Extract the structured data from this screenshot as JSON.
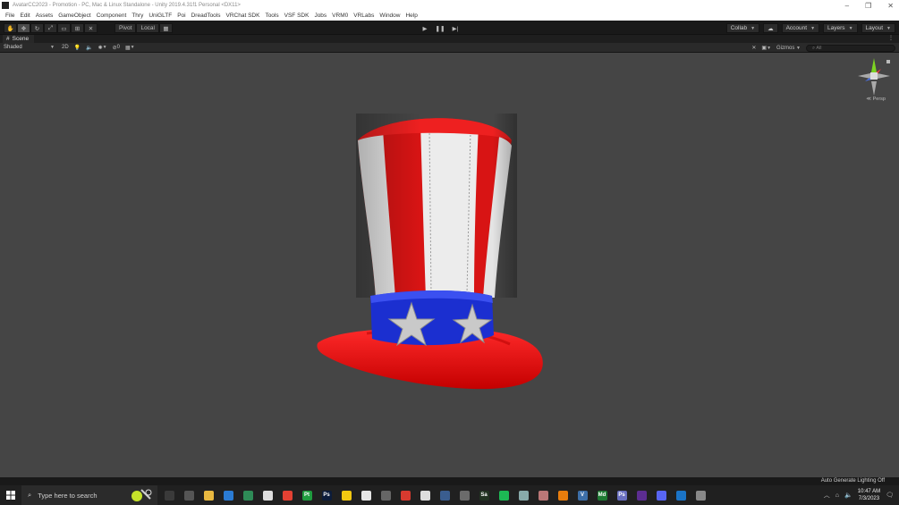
{
  "window": {
    "title": "AvatarCC2023 - Promotion - PC, Mac & Linux Standalone - Unity 2019.4.31f1 Personal <DX11>",
    "controls": [
      "–",
      "❐",
      "✕"
    ]
  },
  "menu": [
    "File",
    "Edit",
    "Assets",
    "GameObject",
    "Component",
    "Thry",
    "UniGLTF",
    "Poi",
    "DreadTools",
    "VRChat SDK",
    "Tools",
    "VSF SDK",
    "Jobs",
    "VRM0",
    "VRLabs",
    "Window",
    "Help"
  ],
  "toolbar": {
    "pivot_label": "Pivot",
    "local_label": "Local",
    "collab_label": "Collab",
    "account_label": "Account",
    "layers_label": "Layers",
    "layout_label": "Layout"
  },
  "scene": {
    "tab_label": "Scene",
    "shading_mode": "Shaded",
    "mode_2d": "2D",
    "fx_count": "0",
    "gizmos_label": "Gizmos",
    "search_placeholder": "All",
    "projection_label": "Persp"
  },
  "status": {
    "lighting": "Auto Generate Lighting Off"
  },
  "taskbar": {
    "search_placeholder": "Type here to search",
    "time": "10:47 AM",
    "date": "7/3/2023",
    "apps": [
      {
        "icon": "terminal-icon",
        "text": "",
        "bg": "#3a3a3a"
      },
      {
        "icon": "globe-icon",
        "text": "",
        "bg": "#555"
      },
      {
        "icon": "folder-icon",
        "text": "",
        "bg": "#e8b840"
      },
      {
        "icon": "chat-icon",
        "text": "",
        "bg": "#2a7bd4"
      },
      {
        "icon": "leaf-icon",
        "text": "",
        "bg": "#2e8b57"
      },
      {
        "icon": "unity-icon",
        "text": "",
        "bg": "#ddd"
      },
      {
        "icon": "chrome-icon",
        "text": "",
        "bg": "#e34133"
      },
      {
        "icon": "pycharm-icon",
        "text": "Pt",
        "bg": "#1f9c3f"
      },
      {
        "icon": "photoshop-icon",
        "text": "Ps",
        "bg": "#0c1c3a"
      },
      {
        "icon": "notes-icon",
        "text": "",
        "bg": "#f2c811"
      },
      {
        "icon": "window-icon",
        "text": "",
        "bg": "#e6e6e6"
      },
      {
        "icon": "shield-icon",
        "text": "",
        "bg": "#666"
      },
      {
        "icon": "red-app-icon",
        "text": "",
        "bg": "#d83a2f"
      },
      {
        "icon": "github-icon",
        "text": "",
        "bg": "#ddd"
      },
      {
        "icon": "blender-icon",
        "text": "",
        "bg": "#3a5d8f"
      },
      {
        "icon": "calculator-icon",
        "text": "",
        "bg": "#6b6b6b"
      },
      {
        "icon": "substance-icon",
        "text": "Sa",
        "bg": "#213321"
      },
      {
        "icon": "spotify-icon",
        "text": "",
        "bg": "#1db954"
      },
      {
        "icon": "cube-icon",
        "text": "",
        "bg": "#8aa"
      },
      {
        "icon": "image-icon",
        "text": "",
        "bg": "#b77"
      },
      {
        "icon": "blender-alt-icon",
        "text": "",
        "bg": "#e87d0d"
      },
      {
        "icon": "vroid-icon",
        "text": "V",
        "bg": "#3d6fa8"
      },
      {
        "icon": "marvelous-icon",
        "text": "Md",
        "bg": "#1e7a33"
      },
      {
        "icon": "photoshop-alt-icon",
        "text": "Ps",
        "bg": "#6a6fc0"
      },
      {
        "icon": "vs-icon",
        "text": "",
        "bg": "#5c2d91"
      },
      {
        "icon": "discord-icon",
        "text": "",
        "bg": "#5865f2"
      },
      {
        "icon": "video-icon",
        "text": "",
        "bg": "#1a73c6"
      },
      {
        "icon": "vscode-icon",
        "text": "",
        "bg": "#888"
      }
    ]
  }
}
